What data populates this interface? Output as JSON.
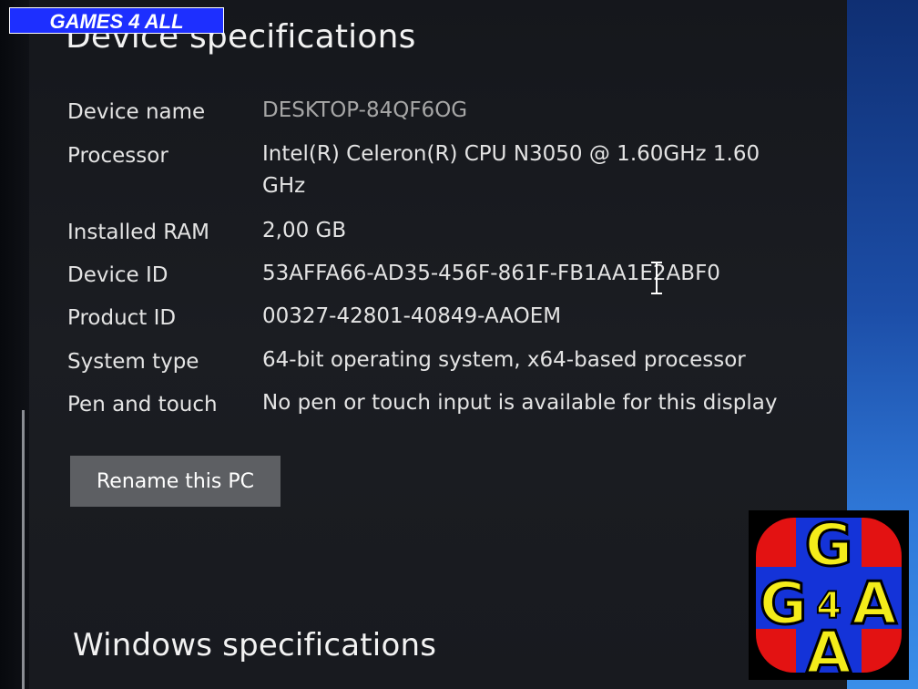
{
  "watermark": {
    "banner_text": "GAMES 4 ALL",
    "logo_text": "G G A A"
  },
  "device_specs": {
    "title": "Device specifications",
    "rows": [
      {
        "label": "Device name",
        "value": "DESKTOP-84QF6OG"
      },
      {
        "label": "Processor",
        "value": "Intel(R) Celeron(R) CPU  N3050  @ 1.60GHz   1.60 GHz"
      },
      {
        "label": "Installed RAM",
        "value": "2,00 GB"
      },
      {
        "label": "Device ID",
        "value": "53AFFA66-AD35-456F-861F-FB1AA1E2ABF0"
      },
      {
        "label": "Product ID",
        "value": "00327-42801-40849-AAOEM"
      },
      {
        "label": "System type",
        "value": "64-bit operating system, x64-based processor"
      },
      {
        "label": "Pen and touch",
        "value": "No pen or touch input is available for this display"
      }
    ],
    "rename_button": "Rename this PC"
  },
  "windows_specs": {
    "title": "Windows specifications"
  },
  "colors": {
    "panel_background": "#1a1c21",
    "button_background": "#5d5f63",
    "banner_blue": "#1d2fff",
    "logo_red": "#e31212",
    "logo_blue": "#1433d8",
    "logo_yellow": "#f4ec1a"
  }
}
